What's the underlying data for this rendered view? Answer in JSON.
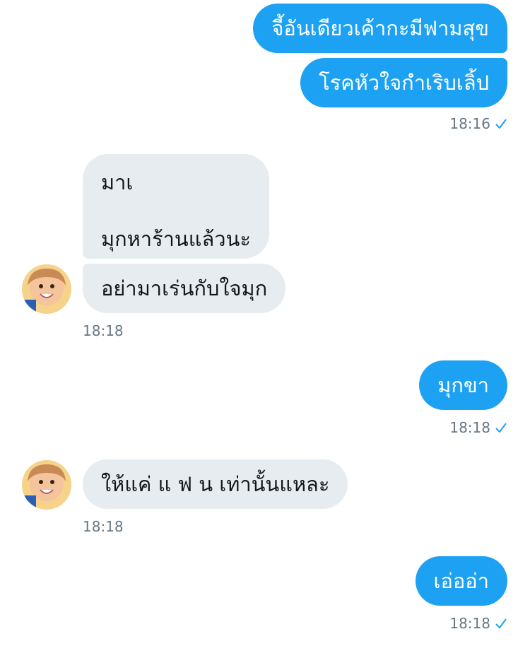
{
  "messages": [
    {
      "side": "sent",
      "text": "จี้อันเดียวเค้ากะมีฟามสุข"
    },
    {
      "side": "sent",
      "text": "โรคหัวใจกำเริบเลิ้ป"
    },
    {
      "side": "sent_time",
      "time": "18:16"
    },
    {
      "side": "recv",
      "lines": [
        "มาเ",
        "",
        "มุกหาร้านแล้วนะ"
      ]
    },
    {
      "side": "recv",
      "text": "อย่ามาเร่นกับใจมุก"
    },
    {
      "side": "recv_time",
      "time": "18:18"
    },
    {
      "side": "sent",
      "text": "มุกขา"
    },
    {
      "side": "sent_time",
      "time": "18:18"
    },
    {
      "side": "recv",
      "text": "ให้แค่ แ ฟ น เท่านั้นแหละ"
    },
    {
      "side": "recv_time",
      "time": "18:18"
    },
    {
      "side": "sent",
      "text": "เอ่ออ่า"
    },
    {
      "side": "sent_time",
      "time": "18:18"
    }
  ],
  "colors": {
    "sent_bubble": "#1da1f2",
    "recv_bubble": "#e6ecf0",
    "timestamp": "#657786",
    "read_check": "#1da1f2"
  },
  "icons": {
    "read_receipt": "check-icon",
    "contact_avatar": "avatar"
  }
}
